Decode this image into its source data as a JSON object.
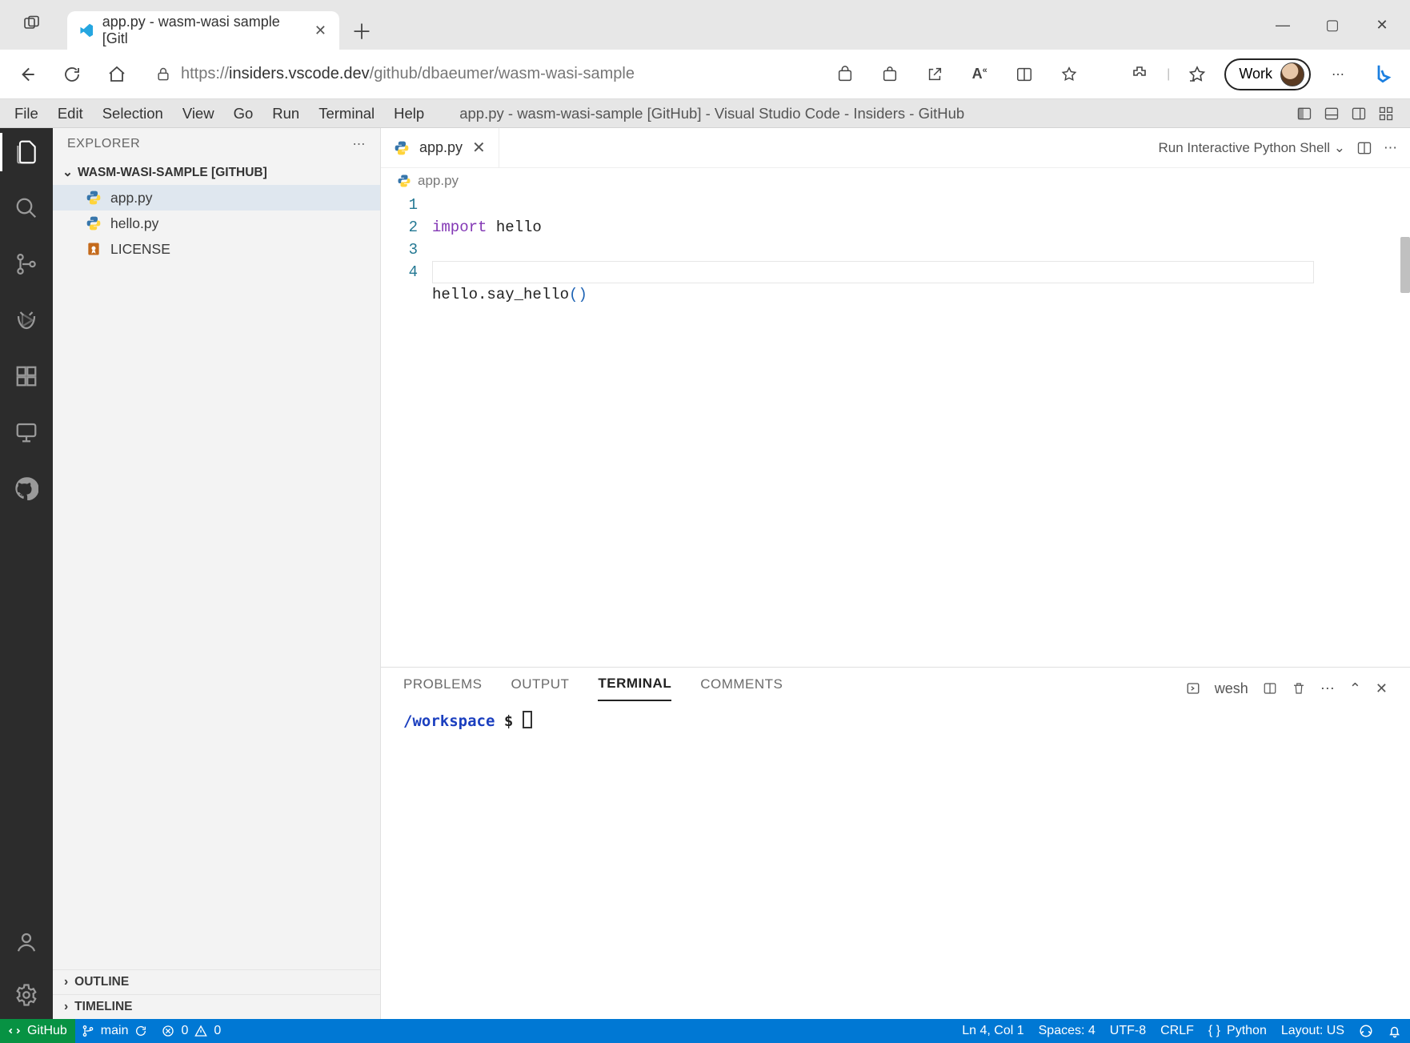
{
  "browser": {
    "tab_title": "app.py - wasm-wasi sample [Gitl",
    "url_scheme": "https://",
    "url_host": "insiders.vscode.dev",
    "url_path": "/github/dbaeumer/wasm-wasi-sample",
    "profile_label": "Work"
  },
  "menubar": {
    "items": [
      "File",
      "Edit",
      "Selection",
      "View",
      "Go",
      "Run",
      "Terminal",
      "Help"
    ],
    "window_title": "app.py - wasm-wasi-sample [GitHub] - Visual Studio Code - Insiders - GitHub"
  },
  "sidebar": {
    "title": "EXPLORER",
    "section": "WASM-WASI-SAMPLE [GITHUB]",
    "files": [
      {
        "name": "app.py",
        "icon": "python",
        "selected": true
      },
      {
        "name": "hello.py",
        "icon": "python",
        "selected": false
      },
      {
        "name": "LICENSE",
        "icon": "license",
        "selected": false
      }
    ],
    "collapsed": [
      "OUTLINE",
      "TIMELINE"
    ]
  },
  "editor": {
    "tab_filename": "app.py",
    "breadcrumb": "app.py",
    "run_button_label": "Run Interactive Python Shell",
    "lines": {
      "l1_kw": "import",
      "l1_rest": " hello",
      "l2": "",
      "l3_plain_a": "hello",
      "l3_dot": ".",
      "l3_plain_b": "say_hello",
      "l3_paren": "()",
      "l4": ""
    },
    "line_numbers": [
      "1",
      "2",
      "3",
      "4"
    ],
    "cursor_line_index": 3
  },
  "panel": {
    "tabs": [
      "PROBLEMS",
      "OUTPUT",
      "TERMINAL",
      "COMMENTS"
    ],
    "active_tab": "TERMINAL",
    "shell_label": "wesh",
    "terminal_cwd": "/workspace",
    "terminal_prompt": "$"
  },
  "statusbar": {
    "remote": "GitHub",
    "branch": "main",
    "errors": "0",
    "warnings": "0",
    "cursor": "Ln 4, Col 1",
    "spaces": "Spaces: 4",
    "encoding": "UTF-8",
    "eol": "CRLF",
    "lang": "Python",
    "layout": "Layout: US"
  }
}
